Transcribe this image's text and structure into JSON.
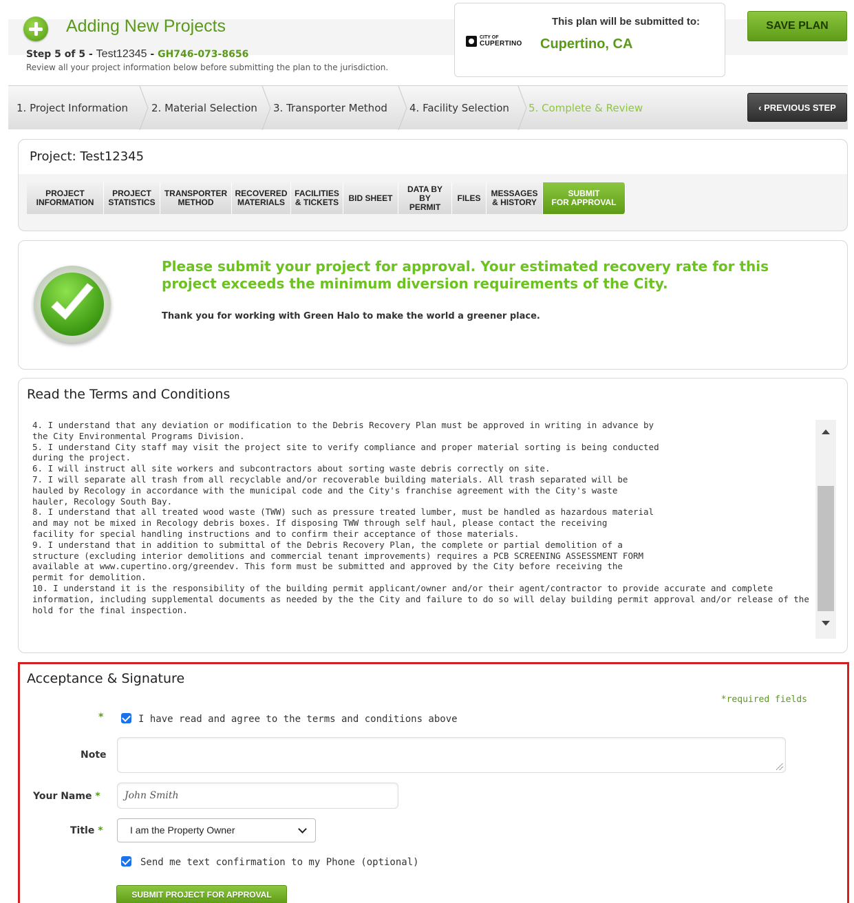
{
  "header": {
    "title": "Adding New Projects",
    "step_prefix": "Step 5 of 5 - ",
    "project_name": "Test12345",
    "separator": " - ",
    "project_id": "GH746-073-8656",
    "review_text": "Review all your project information below before submitting the plan to the jurisdiction.",
    "save_label": "SAVE PLAN"
  },
  "submit_to": {
    "label": "This plan will be submitted to:",
    "logo_city_of": "CITY OF",
    "logo_name": "CUPERTINO",
    "city": "Cupertino, CA"
  },
  "steps": [
    {
      "label": "1. Project Information",
      "active": false
    },
    {
      "label": "2. Material Selection",
      "active": false
    },
    {
      "label": "3. Transporter Method",
      "active": false
    },
    {
      "label": "4. Facility Selection",
      "active": false
    },
    {
      "label": "5. Complete & Review",
      "active": true
    }
  ],
  "prev_step_label": "‹ PREVIOUS STEP",
  "project": {
    "title": "Project: Test12345",
    "tabs": [
      {
        "line1": "PROJECT",
        "line2": "INFORMATION"
      },
      {
        "line1": "PROJECT",
        "line2": "STATISTICS"
      },
      {
        "line1": "TRANSPORTER",
        "line2": "METHOD"
      },
      {
        "line1": "RECOVERED",
        "line2": "MATERIALS"
      },
      {
        "line1": "FACILITIES",
        "line2": "& TICKETS"
      },
      {
        "line1": "BID SHEET",
        "line2": ""
      },
      {
        "line1": "DATA BY",
        "line2": "BY PERMIT"
      },
      {
        "line1": "FILES",
        "line2": ""
      },
      {
        "line1": "MESSAGES",
        "line2": "& HISTORY"
      },
      {
        "line1": "SUBMIT",
        "line2": "FOR APPROVAL"
      }
    ]
  },
  "message": {
    "headline": "Please submit your project for approval. Your estimated recovery rate for this project exceeds the minimum diversion requirements of the City.",
    "sub": "Thank you for working with Green Halo to make the world a greener place."
  },
  "terms": {
    "title": "Read the Terms and Conditions",
    "lines": [
      "4. I understand that any deviation or modification to the Debris Recovery Plan must be approved in writing in advance by",
      "the City Environmental Programs Division.",
      "5. I understand City staff may visit the project site to verify compliance and proper material sorting is being conducted",
      "during the project.",
      "6. I will instruct all site workers and subcontractors about sorting waste debris correctly on site.",
      "7. I will separate all trash from all recyclable and/or recoverable building materials. All trash separated will be",
      "hauled by Recology in accordance with the municipal code and the City's franchise agreement with the City's waste",
      "hauler, Recology South Bay.",
      "8. I understand that all treated wood waste (TWW) such as pressure treated lumber, must be handled as hazardous material",
      "and may not be mixed in Recology debris boxes. If disposing TWW through self haul, please contact the receiving",
      "facility for special handling instructions and to confirm their acceptance of those materials.",
      "9. I understand that in addition to submittal of the Debris Recovery Plan, the complete or partial demolition of a",
      "structure (excluding interior demolitions and commercial tenant improvements) requires a PCB SCREENING ASSESSMENT FORM",
      "available at www.cupertino.org/greendev. This form must be submitted and approved by the City before receiving the",
      "permit for demolition.",
      "10. I understand it is the responsibility of the building permit applicant/owner and/or their agent/contractor to provide accurate and complete",
      "information, including supplemental documents as needed by the the City and failure to do so will delay building permit approval and/or release of the",
      "hold for the final inspection."
    ]
  },
  "acceptance": {
    "title": "Acceptance & Signature",
    "required_note": "*required fields",
    "required_mark": "*",
    "agree_label": "I have read and agree to the terms and conditions above",
    "agree_checked": true,
    "note_label": "Note",
    "note_value": "",
    "name_label": "Your Name",
    "name_value": "John Smith",
    "title_label": "Title",
    "title_value": "I am the Property Owner",
    "text_confirm_label": "Send me text confirmation to my Phone (optional)",
    "text_confirm_checked": true,
    "submit_label": "SUBMIT PROJECT FOR APPROVAL"
  },
  "colors": {
    "brand_green": "#5a9a1a",
    "accent_green": "#8dc63f",
    "highlight_red": "#d21f1f"
  }
}
